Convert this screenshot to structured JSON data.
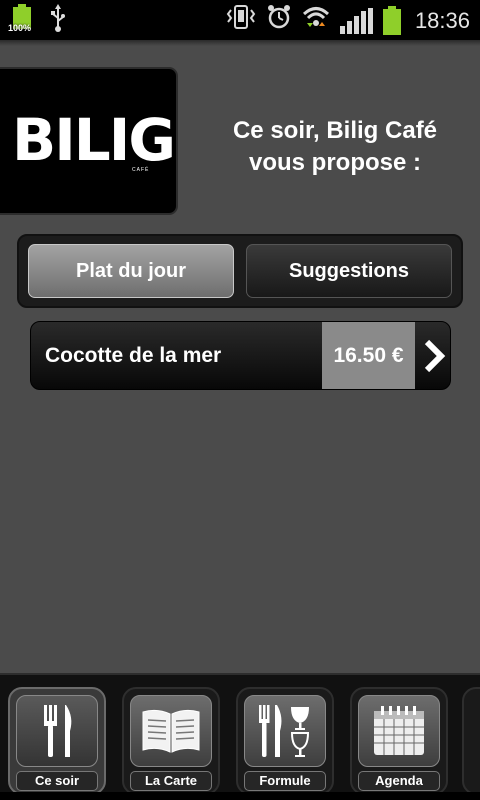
{
  "status_bar": {
    "battery_small_percent": "100%",
    "time": "18:36"
  },
  "logo": {
    "text": "BILIG",
    "subtext": "CAFÉ"
  },
  "intro": {
    "line1": "Ce soir, Bilig Café",
    "line2": "vous propose :"
  },
  "tabs": [
    {
      "label": "Plat du jour",
      "selected": true
    },
    {
      "label": "Suggestions",
      "selected": false
    }
  ],
  "dishes": [
    {
      "name": "Cocotte de la mer",
      "price": "16.50 €"
    }
  ],
  "bottom_nav": [
    {
      "label": "Ce soir",
      "icon": "fork-knife-icon",
      "selected": true
    },
    {
      "label": "La Carte",
      "icon": "open-book-icon",
      "selected": false
    },
    {
      "label": "Formule",
      "icon": "fork-knife-glass-icon",
      "selected": false
    },
    {
      "label": "Agenda",
      "icon": "calendar-icon",
      "selected": false
    }
  ],
  "colors": {
    "background": "#4b4b4b",
    "battery_green": "#8fcf2a",
    "price_bg": "#8a8a8a"
  }
}
